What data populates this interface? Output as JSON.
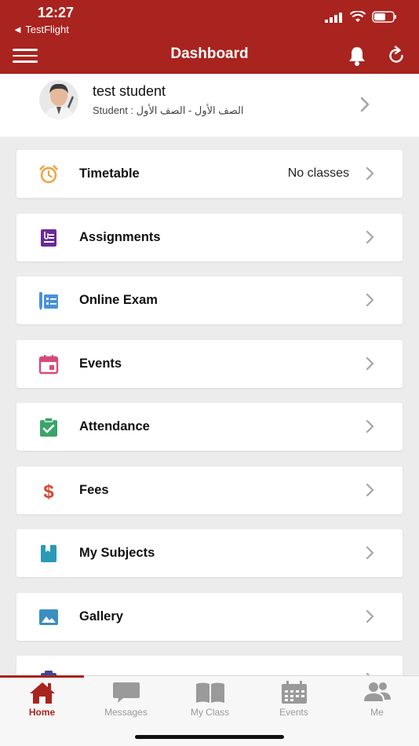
{
  "status": {
    "time": "12:27",
    "back_label": "◄ TestFlight"
  },
  "header": {
    "title": "Dashboard"
  },
  "profile": {
    "name": "test student",
    "role_line": "Student :  الصف الأول - الصف الأول"
  },
  "menu": {
    "items": [
      {
        "label": "Timetable",
        "value": "No classes",
        "icon": "alarm-clock-icon",
        "color": "#f0a23a"
      },
      {
        "label": "Assignments",
        "value": "",
        "icon": "assignment-icon",
        "color": "#6a2a9a"
      },
      {
        "label": "Online Exam",
        "value": "",
        "icon": "online-exam-icon",
        "color": "#4a90d9"
      },
      {
        "label": "Events",
        "value": "",
        "icon": "calendar-icon",
        "color": "#d64a7a"
      },
      {
        "label": "Attendance",
        "value": "",
        "icon": "attendance-icon",
        "color": "#3aa36a"
      },
      {
        "label": "Fees",
        "value": "",
        "icon": "dollar-icon",
        "color": "#d9452f"
      },
      {
        "label": "My Subjects",
        "value": "",
        "icon": "book-icon",
        "color": "#2a9ab8"
      },
      {
        "label": "Gallery",
        "value": "",
        "icon": "gallery-icon",
        "color": "#3a8fc0"
      }
    ]
  },
  "tabs": [
    {
      "label": "Home",
      "icon": "home-icon"
    },
    {
      "label": "Messages",
      "icon": "messages-icon"
    },
    {
      "label": "My Class",
      "icon": "my-class-icon"
    },
    {
      "label": "Events",
      "icon": "events-icon"
    },
    {
      "label": "Me",
      "icon": "me-icon"
    }
  ],
  "colors": {
    "brand": "#a9231f",
    "background": "#ececec"
  }
}
